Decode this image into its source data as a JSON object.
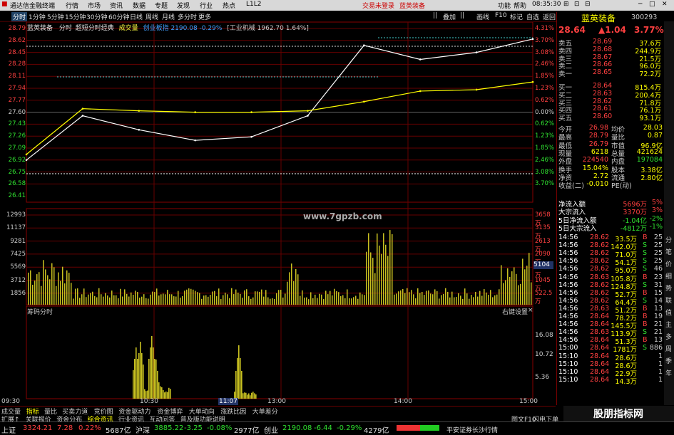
{
  "app": {
    "title": "通达信金融终端",
    "menu": [
      "行情",
      "市场",
      "资讯",
      "数据",
      "专题",
      "发现",
      "行业",
      "热点",
      "L1L2"
    ],
    "alert1": "交易未登录",
    "alert2": "蓝英装备",
    "right_menu": [
      "功能",
      "帮助"
    ],
    "clock": "08:35:30"
  },
  "toolbar": {
    "periods": [
      "分时",
      "1分钟",
      "5分钟",
      "15分钟",
      "30分钟",
      "60分钟",
      "日线",
      "周线",
      "月线",
      "多分时",
      "更多"
    ],
    "selected_period": "分时",
    "tools": [
      "||",
      "叠加",
      "||",
      "画线",
      "F10",
      "标记",
      "自选",
      "返回"
    ]
  },
  "chart_header": {
    "name": "蓝英装备",
    "mode": "分时",
    "indicator": "超短分时经典",
    "vol_label": "成交量",
    "index_label": "创业板指",
    "index_value": "2190.08",
    "index_change": "-0.29%",
    "sector_label": "[工业机械",
    "sector_value": "1962.70",
    "sector_change": "1.64%]"
  },
  "price_axis": {
    "left": [
      "28.79",
      "28.62",
      "28.45",
      "28.28",
      "28.11",
      "27.94",
      "27.77",
      "27.60",
      "27.43",
      "27.26",
      "27.09",
      "26.92",
      "26.75",
      "26.58",
      "26.41"
    ],
    "right": [
      "4.31%",
      "3.70%",
      "3.08%",
      "2.46%",
      "1.85%",
      "1.23%",
      "0.62%",
      "0.00%",
      "0.62%",
      "1.23%",
      "1.85%",
      "2.46%",
      "3.08%",
      "3.70%"
    ]
  },
  "volume_axis": {
    "left": [
      "12993",
      "11137",
      "9281",
      "7425",
      "5569",
      "3712",
      "1856"
    ],
    "right": [
      "3658万",
      "3135万",
      "2613万",
      "2090万",
      "1568万",
      "1045万",
      "522.5万"
    ],
    "current": "5104"
  },
  "chip_panel": {
    "title": "筹码分时",
    "setting": "右键设置",
    "right_axis": [
      "16.08",
      "10.72",
      "5.36"
    ]
  },
  "time_axis": [
    "09:30",
    "10:30",
    "11:07",
    "13:00",
    "14:00",
    "15:00"
  ],
  "watermark": "www.7gpzb.com",
  "chart_data": {
    "type": "line",
    "x": [
      "09:30",
      "10:00",
      "10:30",
      "11:00",
      "11:30",
      "13:00",
      "13:30",
      "14:00",
      "14:30",
      "15:00"
    ],
    "series": [
      {
        "name": "price",
        "values": [
          26.92,
          27.55,
          27.35,
          27.2,
          27.25,
          27.55,
          28.55,
          28.35,
          28.45,
          28.64
        ]
      },
      {
        "name": "avg",
        "values": [
          27.0,
          27.65,
          27.62,
          27.6,
          27.6,
          27.62,
          27.75,
          27.9,
          27.92,
          28.03
        ]
      }
    ],
    "ylim": [
      26.41,
      28.79
    ]
  },
  "quote": {
    "name": "蓝英装备",
    "code": "300293",
    "price": "28.64",
    "change": "▲1.04",
    "pct": "3.77%",
    "asks": [
      {
        "label": "卖五",
        "price": "28.69",
        "vol": "37.6万"
      },
      {
        "label": "卖四",
        "price": "28.68",
        "vol": "244.9万"
      },
      {
        "label": "卖三",
        "price": "28.67",
        "vol": "21.5万"
      },
      {
        "label": "卖二",
        "price": "28.66",
        "vol": "96.0万"
      },
      {
        "label": "卖一",
        "price": "28.65",
        "vol": "72.2万"
      }
    ],
    "bids": [
      {
        "label": "买一",
        "price": "28.64",
        "vol": "815.4万"
      },
      {
        "label": "买二",
        "price": "28.63",
        "vol": "200.4万"
      },
      {
        "label": "买三",
        "price": "28.62",
        "vol": "71.8万"
      },
      {
        "label": "买四",
        "price": "28.61",
        "vol": "76.1万"
      },
      {
        "label": "买五",
        "price": "28.60",
        "vol": "93.1万"
      }
    ],
    "stats": [
      {
        "l1": "今开",
        "v1": "26.98",
        "l2": "均价",
        "v2": "28.03"
      },
      {
        "l1": "最高",
        "v1": "28.79",
        "l2": "量比",
        "v2": "0.87"
      },
      {
        "l1": "最低",
        "v1": "26.79",
        "l2": "市值",
        "v2": "96.9亿"
      },
      {
        "l1": "现量",
        "v1": "6218",
        "l2": "总量",
        "v2": "421624"
      },
      {
        "l1": "外盘",
        "v1": "224540",
        "l2": "内盘",
        "v2": "197084"
      },
      {
        "l1": "换手",
        "v1": "15.04%",
        "l2": "股本",
        "v2": "3.38亿"
      },
      {
        "l1": "净资",
        "v1": "2.72",
        "l2": "流通",
        "v2": "2.80亿"
      },
      {
        "l1": "收益(二)",
        "v1": "-0.010",
        "l2": "PE(动)",
        "v2": ""
      }
    ],
    "flows": [
      {
        "label": "净流入额",
        "value": "5696万",
        "pct": "5%"
      },
      {
        "label": "大宗流入",
        "value": "3370万",
        "pct": "3%"
      },
      {
        "label": "5日净流入额",
        "value": "-1.04亿",
        "pct": "-2%"
      },
      {
        "label": "5日大宗流入",
        "value": "-4812万",
        "pct": "-1%"
      }
    ],
    "ticks": [
      {
        "t": "14:56",
        "p": "28.62",
        "v": "33.5万",
        "s": "B",
        "n": "25"
      },
      {
        "t": "14:56",
        "p": "28.62",
        "v": "142.0万",
        "s": "S",
        "n": "25"
      },
      {
        "t": "14:56",
        "p": "28.62",
        "v": "71.0万",
        "s": "S",
        "n": "25"
      },
      {
        "t": "14:56",
        "p": "28.62",
        "v": "54.1万",
        "s": "S",
        "n": "25"
      },
      {
        "t": "14:56",
        "p": "28.62",
        "v": "95.0万",
        "s": "S",
        "n": "46"
      },
      {
        "t": "14:56",
        "p": "28.63",
        "v": "105.8万",
        "s": "B",
        "n": "23"
      },
      {
        "t": "14:56",
        "p": "28.62",
        "v": "124.8万",
        "s": "S",
        "n": "31"
      },
      {
        "t": "14:56",
        "p": "28.62",
        "v": "52.7万",
        "s": "B",
        "n": "15"
      },
      {
        "t": "14:56",
        "p": "28.62",
        "v": "64.4万",
        "s": "S",
        "n": "14"
      },
      {
        "t": "14:56",
        "p": "28.63",
        "v": "51.2万",
        "s": "B",
        "n": "13"
      },
      {
        "t": "14:56",
        "p": "28.64",
        "v": "78.2万",
        "s": "B",
        "n": "19"
      },
      {
        "t": "14:56",
        "p": "28.64",
        "v": "145.5万",
        "s": "B",
        "n": "21"
      },
      {
        "t": "14:56",
        "p": "28.63",
        "v": "113.9万",
        "s": "S",
        "n": "21"
      },
      {
        "t": "14:56",
        "p": "28.64",
        "v": "51.3万",
        "s": "B",
        "n": "13"
      },
      {
        "t": "15:00",
        "p": "28.64",
        "v": "1781万",
        "s": "S",
        "n": "886"
      },
      {
        "t": "15:10",
        "p": "28.64",
        "v": "28.6万",
        "s": "",
        "n": "1"
      },
      {
        "t": "15:10",
        "p": "28.64",
        "v": "28.6万",
        "s": "",
        "n": "1"
      },
      {
        "t": "15:10",
        "p": "28.64",
        "v": "22.9万",
        "s": "",
        "n": "1"
      },
      {
        "t": "15:10",
        "p": "28.64",
        "v": "14.3万",
        "s": "",
        "n": "1"
      }
    ]
  },
  "sidebar_labels": [
    "分",
    "笔",
    "价",
    "细",
    "势",
    "联",
    "值",
    "主",
    "多",
    "周",
    "季",
    "年"
  ],
  "bottom_tabs": [
    "成交量",
    "指标",
    "量比",
    "买卖力道",
    "竞价图",
    "资金驱动力",
    "资金博弈",
    "大单动向",
    "涨跌比因",
    "大单差分"
  ],
  "bottom_tabs2": [
    "扩展↑",
    "关联报价",
    "资金分布",
    "综合资讯",
    "行业资讯",
    "互动问答",
    "普及版功能说明"
  ],
  "selected_tab": "指标",
  "status_right": "图文F10",
  "status_right2": "闪电下单",
  "index_bar": {
    "items": [
      {
        "name": "上证",
        "value": "3324.21",
        "chg": "7.28",
        "pct": "0.22%",
        "amt": "5687亿",
        "color": "red"
      },
      {
        "name": "沪深",
        "value": "3885.22",
        "chg": "-3.25",
        "pct": "-0.08%",
        "amt": "2977亿",
        "color": "green"
      },
      {
        "name": "创业",
        "value": "2190.08",
        "chg": "-6.44",
        "pct": "-0.29%",
        "amt": "4279亿",
        "color": "green"
      }
    ],
    "broker": "平安证券长沙行情"
  },
  "brand_watermark": "股朋指标网\nwww.7gpzb.com"
}
